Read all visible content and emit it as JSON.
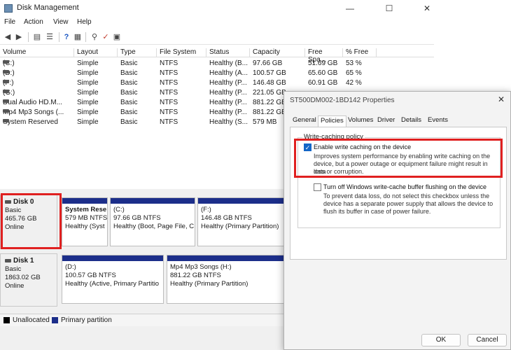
{
  "window": {
    "title": "Disk Management",
    "minimize": "—",
    "maximize": "☐",
    "close": "✕"
  },
  "menu": [
    "File",
    "Action",
    "View",
    "Help"
  ],
  "columns": [
    "Volume",
    "Layout",
    "Type",
    "File System",
    "Status",
    "Capacity",
    "Free Spa...",
    "% Free"
  ],
  "volumes": [
    [
      "(C:)",
      "Simple",
      "Basic",
      "NTFS",
      "Healthy (B...",
      "97.66 GB",
      "51.69 GB",
      "53 %"
    ],
    [
      "(D:)",
      "Simple",
      "Basic",
      "NTFS",
      "Healthy (A...",
      "100.57 GB",
      "65.60 GB",
      "65 %"
    ],
    [
      "(F:)",
      "Simple",
      "Basic",
      "NTFS",
      "Healthy (P...",
      "146.48 GB",
      "60.91 GB",
      "42 %"
    ],
    [
      "(G:)",
      "Simple",
      "Basic",
      "NTFS",
      "Healthy (P...",
      "221.05 GB",
      "",
      ""
    ],
    [
      "Dual Audio HD.M...",
      "Simple",
      "Basic",
      "NTFS",
      "Healthy (P...",
      "881.22 GB",
      "",
      ""
    ],
    [
      "Mp4 Mp3 Songs (...",
      "Simple",
      "Basic",
      "NTFS",
      "Healthy (P...",
      "881.22 GB",
      "",
      ""
    ],
    [
      "System Reserved",
      "Simple",
      "Basic",
      "NTFS",
      "Healthy (S...",
      "579 MB",
      "",
      ""
    ]
  ],
  "disk0": {
    "name": "Disk 0",
    "type": "Basic",
    "size": "465.76 GB",
    "status": "Online",
    "parts": [
      {
        "l1": "System Rese",
        "l2": "579 MB NTFS",
        "l3": "Healthy (Syst"
      },
      {
        "l1": "(C:)",
        "l2": "97.66 GB NTFS",
        "l3": "Healthy (Boot, Page File, C"
      },
      {
        "l1": "(F:)",
        "l2": "146.48 GB NTFS",
        "l3": "Healthy (Primary Partition)"
      }
    ]
  },
  "disk1": {
    "name": "Disk 1",
    "type": "Basic",
    "size": "1863.02 GB",
    "status": "Online",
    "parts": [
      {
        "l1": "(D:)",
        "l2": "100.57 GB NTFS",
        "l3": "Healthy (Active, Primary Partitio"
      },
      {
        "l1": "Mp4 Mp3 Songs  (H:)",
        "l2": "881.22 GB NTFS",
        "l3": "Healthy (Primary Partition)"
      }
    ]
  },
  "legend": {
    "unallocated": "Unallocated",
    "primary": "Primary partition"
  },
  "dialog": {
    "title": "ST500DM002-1BD142 Properties",
    "tabs": [
      "General",
      "Policies",
      "Volumes",
      "Driver",
      "Details",
      "Events"
    ],
    "group_label": "Write-caching policy",
    "opt1_label": "Enable write caching on the device",
    "opt1_desc1": "Improves system performance by enabling write caching on the",
    "opt1_desc2": "device, but a power outage or equipment failure might result in data",
    "opt1_desc3": "loss or corruption.",
    "opt2_label": "Turn off Windows write-cache buffer flushing on the device",
    "opt2_desc1": "To prevent data loss, do not select this checkbox unless the",
    "opt2_desc2": "device has a separate power supply that allows the device to",
    "opt2_desc3": "flush its buffer in case of power failure.",
    "ok": "OK",
    "cancel": "Cancel"
  },
  "colors": {
    "primary_partition": "#1c2e8a",
    "highlight": "#e02020"
  }
}
